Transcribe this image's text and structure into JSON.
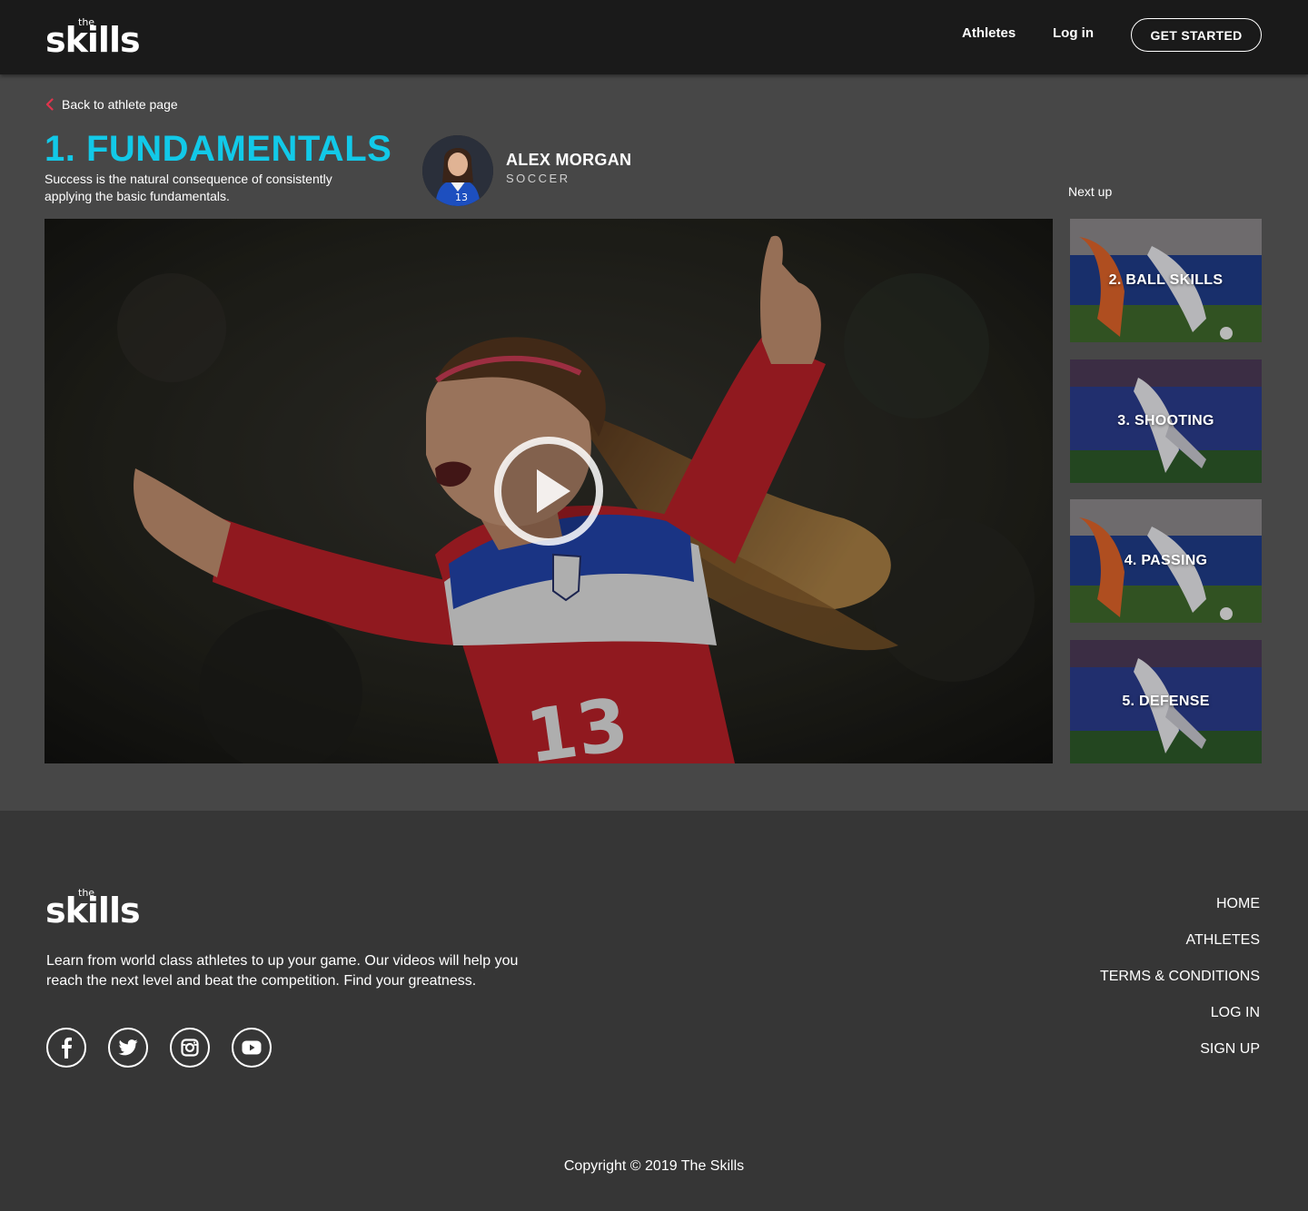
{
  "header": {
    "logo_small": "the",
    "logo_word": "skills",
    "nav": [
      "Athletes",
      "Log in"
    ],
    "cta": "GET STARTED"
  },
  "lesson": {
    "back_label": "Back to athlete page",
    "title": "1. FUNDAMENTALS",
    "description": "Success is the natural consequence of consistently applying the basic fundamentals.",
    "athlete_name": "ALEX MORGAN",
    "sport": "SOCCER",
    "next_up_label": "Next up",
    "jersey_number": "13"
  },
  "playlist": [
    {
      "label": "2. BALL SKILLS"
    },
    {
      "label": "3. SHOOTING"
    },
    {
      "label": "4. PASSING"
    },
    {
      "label": "5. DEFENSE"
    }
  ],
  "footer": {
    "logo_small": "the",
    "logo_word": "skills",
    "description": "Learn from world class athletes to up your game. Our videos will help you reach the next level and beat the competition. Find your greatness.",
    "social": [
      "facebook-icon",
      "twitter-icon",
      "instagram-icon",
      "youtube-icon"
    ],
    "links": [
      "HOME",
      "ATHLETES",
      "TERMS & CONDITIONS",
      "LOG IN",
      "SIGN UP"
    ],
    "copyright": "Copyright © 2019 The Skills"
  },
  "colors": {
    "accent": "#12c9e8",
    "back_chevron": "#e0344c",
    "header_bg": "#1a1a1a",
    "content_bg": "#474747",
    "footer_bg": "#363636"
  }
}
